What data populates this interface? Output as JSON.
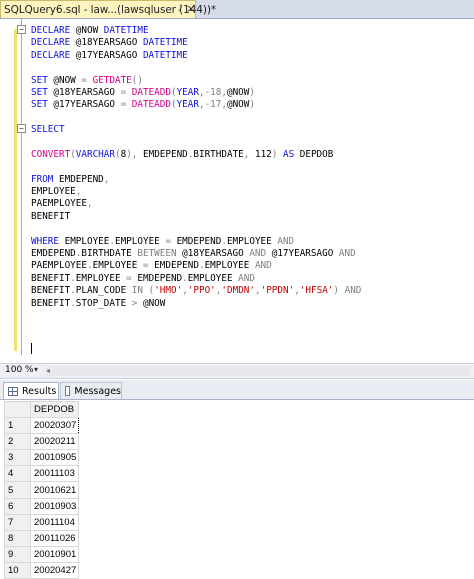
{
  "tab": {
    "title": "SQLQuery6.sql - law...(lawsqluser (144))*",
    "pin_glyph": "⭜",
    "close_glyph": "×"
  },
  "editor": {
    "collapse_glyph": "−",
    "lines": [
      [
        {
          "t": "DECLARE ",
          "c": "kw"
        },
        {
          "t": "@NOW ",
          "c": "txt"
        },
        {
          "t": "DATETIME",
          "c": "kw"
        }
      ],
      [
        {
          "t": "DECLARE ",
          "c": "kw"
        },
        {
          "t": "@18YEARSAGO ",
          "c": "txt"
        },
        {
          "t": "DATETIME",
          "c": "kw"
        }
      ],
      [
        {
          "t": "DECLARE ",
          "c": "kw"
        },
        {
          "t": "@17YEARSAGO ",
          "c": "txt"
        },
        {
          "t": "DATETIME",
          "c": "kw"
        }
      ],
      [],
      [
        {
          "t": "SET ",
          "c": "kw"
        },
        {
          "t": "@NOW ",
          "c": "txt"
        },
        {
          "t": "= ",
          "c": "op"
        },
        {
          "t": "GETDATE",
          "c": "fn"
        },
        {
          "t": "()",
          "c": "op"
        }
      ],
      [
        {
          "t": "SET ",
          "c": "kw"
        },
        {
          "t": "@18YEARSAGO ",
          "c": "txt"
        },
        {
          "t": "= ",
          "c": "op"
        },
        {
          "t": "DATEADD",
          "c": "fn"
        },
        {
          "t": "(",
          "c": "op"
        },
        {
          "t": "YEAR",
          "c": "kw"
        },
        {
          "t": ",",
          "c": "op"
        },
        {
          "t": "-18",
          "c": "op"
        },
        {
          "t": ",",
          "c": "op"
        },
        {
          "t": "@NOW",
          "c": "txt"
        },
        {
          "t": ")",
          "c": "op"
        }
      ],
      [
        {
          "t": "SET ",
          "c": "kw"
        },
        {
          "t": "@17YEARSAGO ",
          "c": "txt"
        },
        {
          "t": "= ",
          "c": "op"
        },
        {
          "t": "DATEADD",
          "c": "fn"
        },
        {
          "t": "(",
          "c": "op"
        },
        {
          "t": "YEAR",
          "c": "kw"
        },
        {
          "t": ",",
          "c": "op"
        },
        {
          "t": "-17",
          "c": "op"
        },
        {
          "t": ",",
          "c": "op"
        },
        {
          "t": "@NOW",
          "c": "txt"
        },
        {
          "t": ")",
          "c": "op"
        }
      ],
      [],
      [
        {
          "t": "SELECT",
          "c": "kw"
        }
      ],
      [],
      [
        {
          "t": "CONVERT",
          "c": "fn"
        },
        {
          "t": "(",
          "c": "op"
        },
        {
          "t": "VARCHAR",
          "c": "kw"
        },
        {
          "t": "(",
          "c": "op"
        },
        {
          "t": "8",
          "c": "txt"
        },
        {
          "t": "), ",
          "c": "op"
        },
        {
          "t": "EMDEPEND",
          "c": "txt"
        },
        {
          "t": ".",
          "c": "op"
        },
        {
          "t": "BIRTHDATE",
          "c": "txt"
        },
        {
          "t": ", ",
          "c": "op"
        },
        {
          "t": "112",
          "c": "txt"
        },
        {
          "t": ") ",
          "c": "op"
        },
        {
          "t": "AS ",
          "c": "kw"
        },
        {
          "t": "DEPDOB",
          "c": "txt"
        }
      ],
      [],
      [
        {
          "t": "FROM ",
          "c": "kw"
        },
        {
          "t": "EMDEPEND",
          "c": "txt"
        },
        {
          "t": ",",
          "c": "op"
        }
      ],
      [
        {
          "t": "EMPLOYEE",
          "c": "txt"
        },
        {
          "t": ",",
          "c": "op"
        }
      ],
      [
        {
          "t": "PAEMPLOYEE",
          "c": "txt"
        },
        {
          "t": ",",
          "c": "op"
        }
      ],
      [
        {
          "t": "BENEFIT",
          "c": "txt"
        }
      ],
      [],
      [
        {
          "t": "WHERE ",
          "c": "kw"
        },
        {
          "t": "EMPLOYEE",
          "c": "txt"
        },
        {
          "t": ".",
          "c": "op"
        },
        {
          "t": "EMPLOYEE ",
          "c": "txt"
        },
        {
          "t": "= ",
          "c": "op"
        },
        {
          "t": "EMDEPEND",
          "c": "txt"
        },
        {
          "t": ".",
          "c": "op"
        },
        {
          "t": "EMPLOYEE ",
          "c": "txt"
        },
        {
          "t": "AND",
          "c": "op"
        }
      ],
      [
        {
          "t": "EMDEPEND",
          "c": "txt"
        },
        {
          "t": ".",
          "c": "op"
        },
        {
          "t": "BIRTHDATE ",
          "c": "txt"
        },
        {
          "t": "BETWEEN ",
          "c": "op"
        },
        {
          "t": "@18YEARSAGO ",
          "c": "txt"
        },
        {
          "t": "AND ",
          "c": "op"
        },
        {
          "t": "@17YEARSAGO ",
          "c": "txt"
        },
        {
          "t": "AND",
          "c": "op"
        }
      ],
      [
        {
          "t": "PAEMPLOYEE",
          "c": "txt"
        },
        {
          "t": ".",
          "c": "op"
        },
        {
          "t": "EMPLOYEE ",
          "c": "txt"
        },
        {
          "t": "= ",
          "c": "op"
        },
        {
          "t": "EMDEPEND",
          "c": "txt"
        },
        {
          "t": ".",
          "c": "op"
        },
        {
          "t": "EMPLOYEE ",
          "c": "txt"
        },
        {
          "t": "AND",
          "c": "op"
        }
      ],
      [
        {
          "t": "BENEFIT",
          "c": "txt"
        },
        {
          "t": ".",
          "c": "op"
        },
        {
          "t": "EMPLOYEE ",
          "c": "txt"
        },
        {
          "t": "= ",
          "c": "op"
        },
        {
          "t": "EMDEPEND",
          "c": "txt"
        },
        {
          "t": ".",
          "c": "op"
        },
        {
          "t": "EMPLOYEE ",
          "c": "txt"
        },
        {
          "t": "AND",
          "c": "op"
        }
      ],
      [
        {
          "t": "BENEFIT",
          "c": "txt"
        },
        {
          "t": ".",
          "c": "op"
        },
        {
          "t": "PLAN_CODE ",
          "c": "txt"
        },
        {
          "t": "IN ",
          "c": "op"
        },
        {
          "t": "(",
          "c": "op"
        },
        {
          "t": "'HMO'",
          "c": "str"
        },
        {
          "t": ",",
          "c": "op"
        },
        {
          "t": "'PPO'",
          "c": "str"
        },
        {
          "t": ",",
          "c": "op"
        },
        {
          "t": "'DMDN'",
          "c": "str"
        },
        {
          "t": ",",
          "c": "op"
        },
        {
          "t": "'PPDN'",
          "c": "str"
        },
        {
          "t": ",",
          "c": "op"
        },
        {
          "t": "'HFSA'",
          "c": "str"
        },
        {
          "t": ") ",
          "c": "op"
        },
        {
          "t": "AND",
          "c": "op"
        }
      ],
      [
        {
          "t": "BENEFIT",
          "c": "txt"
        },
        {
          "t": ".",
          "c": "op"
        },
        {
          "t": "STOP_DATE ",
          "c": "txt"
        },
        {
          "t": "> ",
          "c": "op"
        },
        {
          "t": "@NOW",
          "c": "txt"
        }
      ]
    ]
  },
  "zoom": {
    "label": "100 %",
    "dropdown_glyph": "▾",
    "scroll_left_glyph": "◂"
  },
  "results_tabs": [
    {
      "label": "Results",
      "active": true,
      "icon": "results-grid-icon"
    },
    {
      "label": "Messages",
      "active": false,
      "icon": "messages-icon"
    }
  ],
  "grid": {
    "columns": [
      "DEPDOB"
    ],
    "rows": [
      {
        "num": "1",
        "DEPDOB": "20020307"
      },
      {
        "num": "2",
        "DEPDOB": "20020211"
      },
      {
        "num": "3",
        "DEPDOB": "20010905"
      },
      {
        "num": "4",
        "DEPDOB": "20011103"
      },
      {
        "num": "5",
        "DEPDOB": "20010621"
      },
      {
        "num": "6",
        "DEPDOB": "20010903"
      },
      {
        "num": "7",
        "DEPDOB": "20011104"
      },
      {
        "num": "8",
        "DEPDOB": "20011026"
      },
      {
        "num": "9",
        "DEPDOB": "20010901"
      },
      {
        "num": "10",
        "DEPDOB": "20020427"
      }
    ],
    "selected_row": 0
  }
}
